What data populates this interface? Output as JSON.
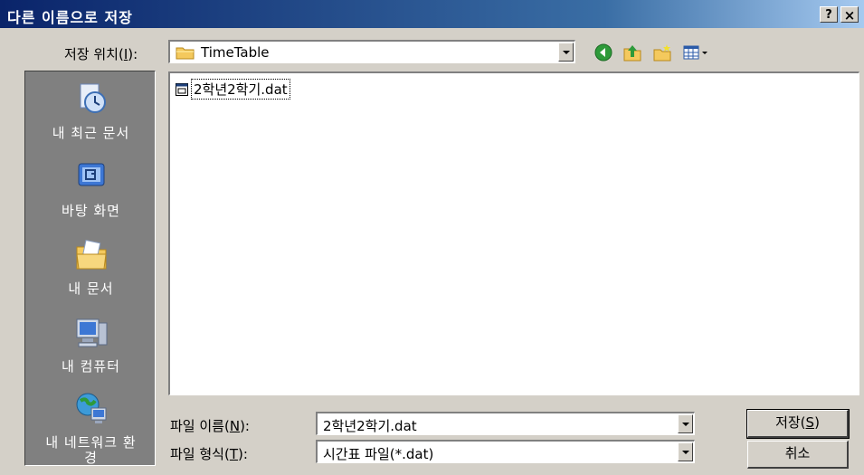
{
  "window": {
    "title": "다른 이름으로 저장",
    "help_glyph": "?",
    "close_glyph": "×"
  },
  "location": {
    "label_prefix": "저장 위치(",
    "label_key": "I",
    "label_suffix": "):",
    "value": "TimeTable"
  },
  "places": [
    {
      "label": "내 최근 문서",
      "icon": "recent-documents-icon"
    },
    {
      "label": "바탕 화면",
      "icon": "desktop-icon"
    },
    {
      "label": "내 문서",
      "icon": "my-documents-icon"
    },
    {
      "label": "내 컴퓨터",
      "icon": "my-computer-icon"
    },
    {
      "label": "내 네트워크 환경",
      "icon": "network-places-icon"
    }
  ],
  "files": [
    {
      "name": "2학년2학기.dat",
      "icon": "data-file-icon"
    }
  ],
  "filename": {
    "label_prefix": "파일 이름(",
    "label_key": "N",
    "label_suffix": "):",
    "value": "2학년2학기.dat"
  },
  "filetype": {
    "label_prefix": "파일 형식(",
    "label_key": "T",
    "label_suffix": "):",
    "value": "시간표 파일(*.dat)"
  },
  "buttons": {
    "save_prefix": "저장(",
    "save_key": "S",
    "save_suffix": ")",
    "cancel": "취소"
  },
  "colors": {
    "title_start": "#0a246a",
    "title_end": "#a6caf0",
    "face": "#d4d0c8",
    "places_bar": "#808080"
  }
}
